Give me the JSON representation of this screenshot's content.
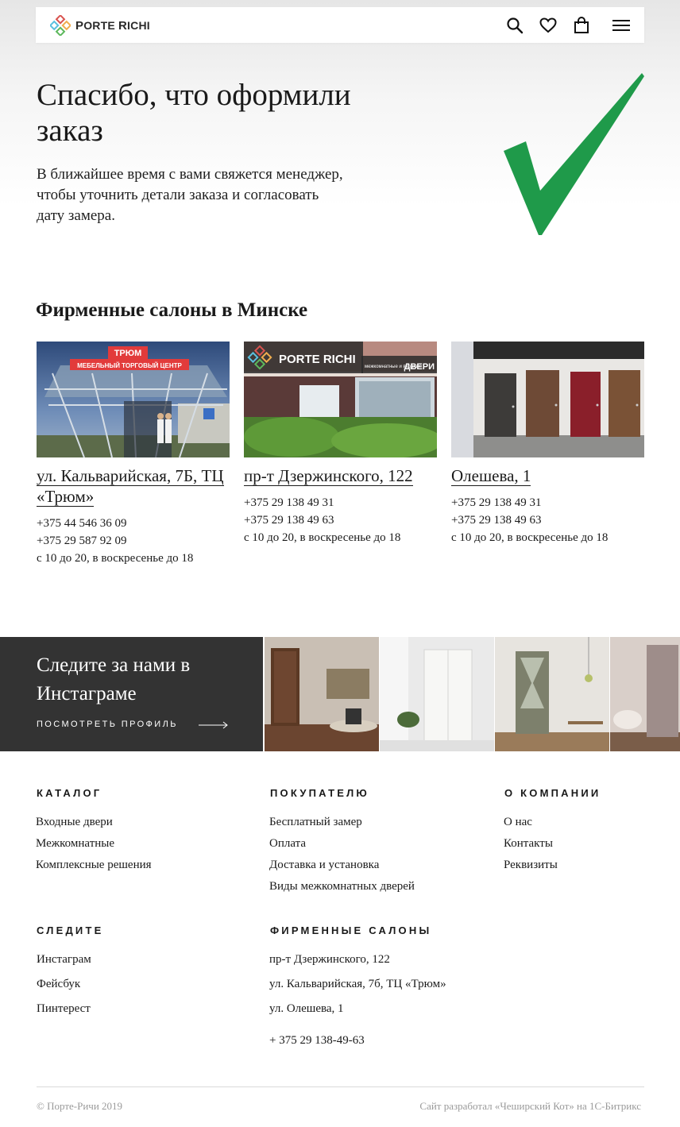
{
  "header": {
    "logo_text_1": "P",
    "logo_text_2": "ORTE ",
    "logo_text_3": "R",
    "logo_text_4": "ICHI",
    "icons": [
      "search-icon",
      "heart-icon",
      "bag-icon",
      "menu-icon"
    ]
  },
  "hero": {
    "title": "Спасибо, что оформили заказ",
    "subtitle": "В ближайшее время с вами свяжется менеджер, чтобы уточнить детали заказа и согласовать дату замера.",
    "check_color": "#1f9a4a"
  },
  "salons": {
    "title": "Фирменные салоны в Минске",
    "items": [
      {
        "address": "ул. Кальварийская, 7Б, ТЦ «Трюм»",
        "phone1": "+375 44 546 36 09",
        "phone2": "+375 29 587 92 09",
        "hours": "с 10 до 20, в воскресенье до 18",
        "sign_top": "ТРЮМ",
        "sign_bottom": "МЕБЕЛЬНЫЙ ТОРГОВЫЙ ЦЕНТР"
      },
      {
        "address": "пр-т Дзержинского, 122",
        "phone1": "+375 29 138 49 31",
        "phone2": "+375 29 138 49 63",
        "hours": "с 10 до 20, в воскресенье до 18",
        "sign_brand": "PORTE RICHI",
        "sign_sub": "межкомнатные и входные",
        "sign_doors": "ДВЕРИ"
      },
      {
        "address": "Олешева, 1",
        "phone1": "+375 29 138 49 31",
        "phone2": "+375 29 138 49 63",
        "hours": "с 10 до 20, в воскресенье до 18"
      }
    ]
  },
  "instagram": {
    "title": "Следите за нами в Инстаграме",
    "link": "ПОСМОТРЕТЬ ПРОФИЛЬ"
  },
  "footer": {
    "catalog": {
      "heading": "КАТАЛОГ",
      "links": [
        "Входные двери",
        "Межкомнатные",
        "Комплексные решения"
      ]
    },
    "buyer": {
      "heading": "ПОКУПАТЕЛЮ",
      "links": [
        "Бесплатный замер",
        "Оплата",
        "Доставка и установка",
        "Виды межкомнатных дверей"
      ]
    },
    "company": {
      "heading": "О КОМПАНИИ",
      "links": [
        "О нас",
        "Контакты",
        "Реквизиты"
      ]
    },
    "follow": {
      "heading": "СЛЕДИТЕ",
      "links": [
        "Инстаграм",
        "Фейсбук",
        "Пинтерест"
      ]
    },
    "salons": {
      "heading": "ФИРМЕННЫЕ САЛОНЫ",
      "links": [
        "пр-т Дзержинского, 122",
        "ул. Кальварийская, 7б, ТЦ «Трюм»",
        "ул. Олешева, 1"
      ],
      "phone": "+ 375 29 138-49-63"
    },
    "copyright": "© Порте-Ричи 2019",
    "developer": "Сайт разработал «Чеширский Кот» на 1С-Битрикс"
  }
}
